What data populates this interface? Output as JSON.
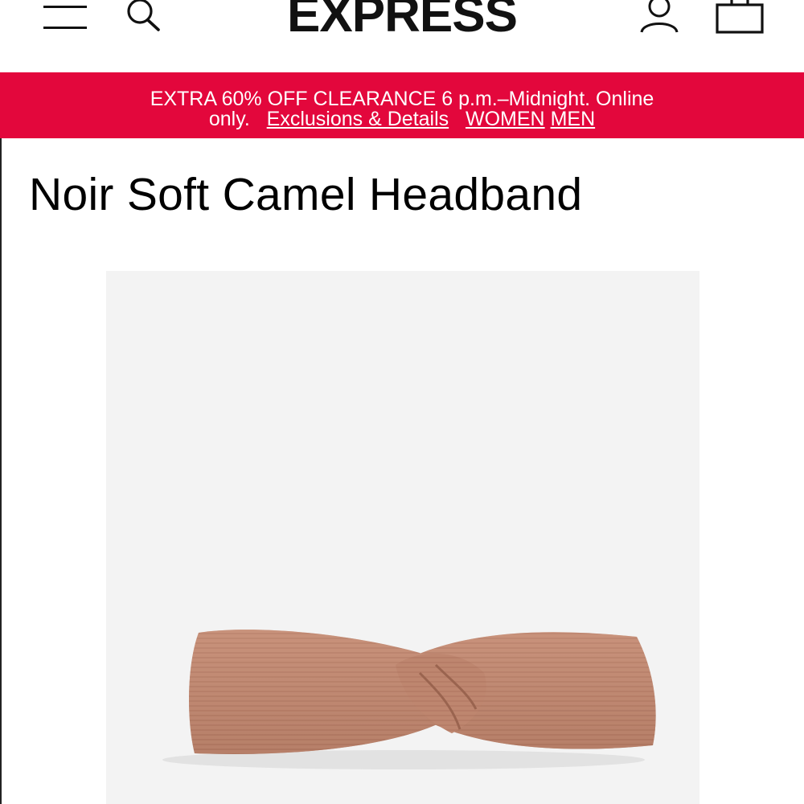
{
  "header": {
    "logo_text": "EXPRESS",
    "menu_icon": "hamburger-menu-icon",
    "search_icon": "search-icon",
    "account_icon": "account-icon",
    "bag_icon": "shopping-bag-icon"
  },
  "promo": {
    "text_line1": "EXTRA 60% OFF CLEARANCE  6 p.m.–Midnight. Online",
    "text_line2_prefix": "only.",
    "details_link": "Exclusions & Details",
    "women_link": "WOMEN",
    "men_link": "MEN",
    "background_color": "#e3073c"
  },
  "product": {
    "title": "Noir Soft Camel Headband",
    "image_background": "#f3f3f3",
    "item_color": "#c28b74"
  }
}
